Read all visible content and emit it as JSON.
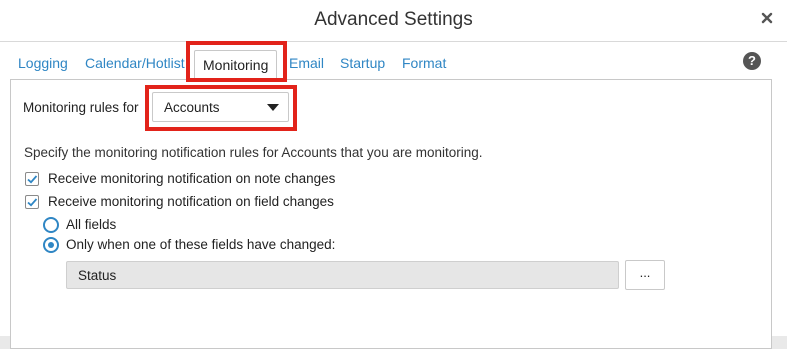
{
  "dialog": {
    "title": "Advanced Settings",
    "close_icon": "close-icon",
    "help_icon": "help-icon",
    "help_glyph": "?"
  },
  "tabs": [
    {
      "label": "Logging"
    },
    {
      "label": "Calendar/Hotlist"
    },
    {
      "label": "Monitoring",
      "active": true
    },
    {
      "label": "Email"
    },
    {
      "label": "Startup"
    },
    {
      "label": "Format"
    }
  ],
  "monitoring": {
    "rules_label": "Monitoring rules for",
    "rules_selected": "Accounts",
    "description": "Specify the monitoring notification rules for Accounts that you are monitoring.",
    "note_changes_label": "Receive monitoring notification on note changes",
    "note_changes_checked": true,
    "field_changes_label": "Receive monitoring notification on field changes",
    "field_changes_checked": true,
    "radio_all_label": "All fields",
    "radio_only_label": "Only when one of these fields have changed:",
    "selected_radio": "only",
    "fields_value": "Status",
    "browse_label": "..."
  },
  "colors": {
    "link": "#2f86c4",
    "highlight": "#e2231a"
  }
}
